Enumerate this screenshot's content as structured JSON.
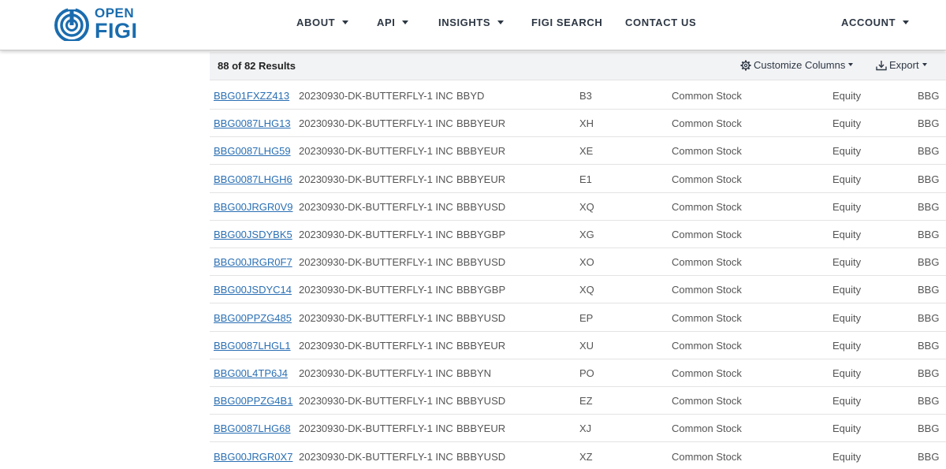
{
  "brand": {
    "open": "OPEN",
    "figi": "FIGI",
    "color": "#1a6cae"
  },
  "nav": {
    "about": "ABOUT",
    "api": "API",
    "insights": "INSIGHTS",
    "figi_search": "FIGI SEARCH",
    "contact_us": "CONTACT US",
    "account": "ACCOUNT"
  },
  "toolbar": {
    "results": "88 of 82 Results",
    "customize": "Customize Columns",
    "export": "Export"
  },
  "rows": [
    {
      "figi": "BBG01FXZZ413",
      "name": "20230930-DK-BUTTERFLY-1 INC",
      "ticker": "BBYD",
      "exch": "B3",
      "sec_type": "Common Stock",
      "market": "Equity",
      "extra": "BBG"
    },
    {
      "figi": "BBG0087LHG13",
      "name": "20230930-DK-BUTTERFLY-1 INC",
      "ticker": "BBBYEUR",
      "exch": "XH",
      "sec_type": "Common Stock",
      "market": "Equity",
      "extra": "BBG"
    },
    {
      "figi": "BBG0087LHG59",
      "name": "20230930-DK-BUTTERFLY-1 INC",
      "ticker": "BBBYEUR",
      "exch": "XE",
      "sec_type": "Common Stock",
      "market": "Equity",
      "extra": "BBG"
    },
    {
      "figi": "BBG0087LHGH6",
      "name": "20230930-DK-BUTTERFLY-1 INC",
      "ticker": "BBBYEUR",
      "exch": "E1",
      "sec_type": "Common Stock",
      "market": "Equity",
      "extra": "BBG"
    },
    {
      "figi": "BBG00JRGR0V9",
      "name": "20230930-DK-BUTTERFLY-1 INC",
      "ticker": "BBBYUSD",
      "exch": "XQ",
      "sec_type": "Common Stock",
      "market": "Equity",
      "extra": "BBG"
    },
    {
      "figi": "BBG00JSDYBK5",
      "name": "20230930-DK-BUTTERFLY-1 INC",
      "ticker": "BBBYGBP",
      "exch": "XG",
      "sec_type": "Common Stock",
      "market": "Equity",
      "extra": "BBG"
    },
    {
      "figi": "BBG00JRGR0F7",
      "name": "20230930-DK-BUTTERFLY-1 INC",
      "ticker": "BBBYUSD",
      "exch": "XO",
      "sec_type": "Common Stock",
      "market": "Equity",
      "extra": "BBG"
    },
    {
      "figi": "BBG00JSDYC14",
      "name": "20230930-DK-BUTTERFLY-1 INC",
      "ticker": "BBBYGBP",
      "exch": "XQ",
      "sec_type": "Common Stock",
      "market": "Equity",
      "extra": "BBG"
    },
    {
      "figi": "BBG00PPZG485",
      "name": "20230930-DK-BUTTERFLY-1 INC",
      "ticker": "BBBYUSD",
      "exch": "EP",
      "sec_type": "Common Stock",
      "market": "Equity",
      "extra": "BBG"
    },
    {
      "figi": "BBG0087LHGL1",
      "name": "20230930-DK-BUTTERFLY-1 INC",
      "ticker": "BBBYEUR",
      "exch": "XU",
      "sec_type": "Common Stock",
      "market": "Equity",
      "extra": "BBG"
    },
    {
      "figi": "BBG00L4TP6J4",
      "name": "20230930-DK-BUTTERFLY-1 INC",
      "ticker": "BBBYN",
      "exch": "PO",
      "sec_type": "Common Stock",
      "market": "Equity",
      "extra": "BBG"
    },
    {
      "figi": "BBG00PPZG4B1",
      "name": "20230930-DK-BUTTERFLY-1 INC",
      "ticker": "BBBYUSD",
      "exch": "EZ",
      "sec_type": "Common Stock",
      "market": "Equity",
      "extra": "BBG"
    },
    {
      "figi": "BBG0087LHG68",
      "name": "20230930-DK-BUTTERFLY-1 INC",
      "ticker": "BBBYEUR",
      "exch": "XJ",
      "sec_type": "Common Stock",
      "market": "Equity",
      "extra": "BBG"
    },
    {
      "figi": "BBG00JRGR0X7",
      "name": "20230930-DK-BUTTERFLY-1 INC",
      "ticker": "BBBYUSD",
      "exch": "XZ",
      "sec_type": "Common Stock",
      "market": "Equity",
      "extra": "BBG"
    }
  ]
}
